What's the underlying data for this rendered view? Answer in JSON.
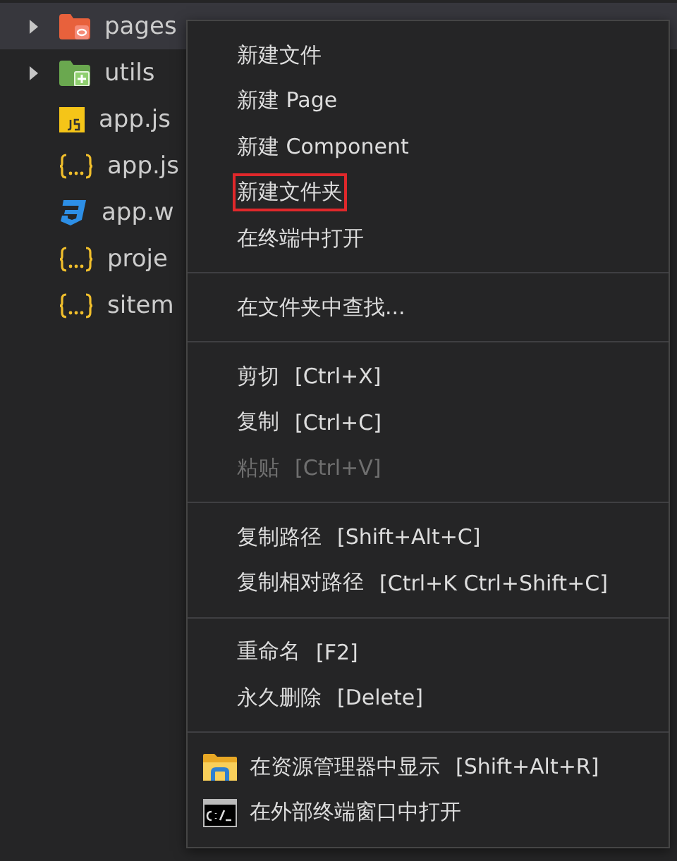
{
  "file_tree": [
    {
      "name": "pages",
      "kind": "pages-folder",
      "expanded": false,
      "selected": true
    },
    {
      "name": "utils",
      "kind": "utils-folder",
      "expanded": false,
      "selected": false
    },
    {
      "name": "app.js",
      "kind": "js",
      "selected": false
    },
    {
      "name": "app.js",
      "kind": "json",
      "selected": false
    },
    {
      "name": "app.w",
      "kind": "css",
      "selected": false
    },
    {
      "name": "proje",
      "kind": "json",
      "selected": false
    },
    {
      "name": "sitem",
      "kind": "json",
      "selected": false
    }
  ],
  "context_menu": [
    {
      "kind": "item",
      "label": "新建文件",
      "disabled": false,
      "outlined": false
    },
    {
      "kind": "item",
      "label": "新建 Page",
      "disabled": false,
      "outlined": false
    },
    {
      "kind": "item",
      "label": "新建 Component",
      "disabled": false,
      "outlined": false
    },
    {
      "kind": "item",
      "label": "新建文件夹",
      "disabled": false,
      "outlined": true
    },
    {
      "kind": "item",
      "label": "在终端中打开",
      "disabled": false,
      "outlined": false
    },
    {
      "kind": "separator"
    },
    {
      "kind": "item",
      "label": "在文件夹中查找...",
      "disabled": false,
      "outlined": false
    },
    {
      "kind": "separator"
    },
    {
      "kind": "item",
      "label": "剪切",
      "shortcut": "[Ctrl+X]",
      "disabled": false,
      "outlined": false
    },
    {
      "kind": "item",
      "label": "复制",
      "shortcut": "[Ctrl+C]",
      "disabled": false,
      "outlined": false
    },
    {
      "kind": "item",
      "label": "粘贴",
      "shortcut": "[Ctrl+V]",
      "disabled": true,
      "outlined": false
    },
    {
      "kind": "separator"
    },
    {
      "kind": "item",
      "label": "复制路径",
      "shortcut": "[Shift+Alt+C]",
      "disabled": false,
      "outlined": false
    },
    {
      "kind": "item",
      "label": "复制相对路径",
      "shortcut": "[Ctrl+K Ctrl+Shift+C]",
      "disabled": false,
      "outlined": false
    },
    {
      "kind": "separator"
    },
    {
      "kind": "item",
      "label": "重命名",
      "shortcut": "[F2]",
      "disabled": false,
      "outlined": false
    },
    {
      "kind": "item",
      "label": "永久删除",
      "shortcut": "[Delete]",
      "disabled": false,
      "outlined": false
    },
    {
      "kind": "separator"
    },
    {
      "kind": "folder-item",
      "label": "在资源管理器中显示",
      "shortcut": "[Shift+Alt+R]",
      "disabled": false,
      "outlined": false
    },
    {
      "kind": "terminal-item",
      "label": "在外部终端窗口中打开",
      "disabled": false,
      "outlined": false
    }
  ]
}
